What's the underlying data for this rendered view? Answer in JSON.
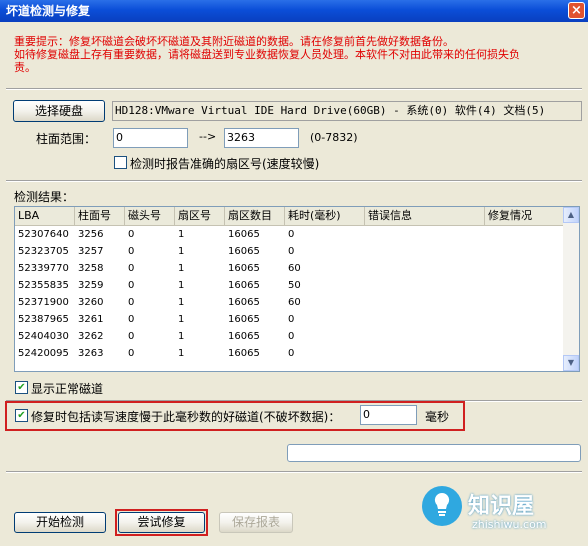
{
  "window": {
    "title": "坏道检测与修复",
    "close_glyph": "×"
  },
  "warning": {
    "line1": "重要提示：修复坏磁道会破坏坏磁道及其附近磁道的数据。请在修复前首先做好数据备份。",
    "line2": "如待修复磁盘上存有重要数据，请将磁盘送到专业数据恢复人员处理。本软件不对由此带来的任何损失负",
    "line3": "责。"
  },
  "disk": {
    "select_button": "选择硬盘",
    "drive_text": "HD128:VMware Virtual IDE Hard Drive(60GB) - 系统(0) 软件(4) 文档(5)"
  },
  "cylinder_range": {
    "label": "柱面范围：",
    "from_value": "0",
    "arrow": "-->",
    "to_value": "3263",
    "range_hint": "(0-7832)"
  },
  "accurate_sector": {
    "checked": false,
    "label": "检测时报告准确的扇区号(速度较慢)"
  },
  "results": {
    "label": "检测结果：",
    "columns": [
      "LBA",
      "柱面号",
      "磁头号",
      "扇区号",
      "扇区数目",
      "耗时(毫秒)",
      "错误信息",
      "修复情况"
    ],
    "rows": [
      [
        "52307640",
        "3256",
        "0",
        "1",
        "16065",
        "0",
        "",
        ""
      ],
      [
        "52323705",
        "3257",
        "0",
        "1",
        "16065",
        "0",
        "",
        ""
      ],
      [
        "52339770",
        "3258",
        "0",
        "1",
        "16065",
        "60",
        "",
        ""
      ],
      [
        "52355835",
        "3259",
        "0",
        "1",
        "16065",
        "50",
        "",
        ""
      ],
      [
        "52371900",
        "3260",
        "0",
        "1",
        "16065",
        "60",
        "",
        ""
      ],
      [
        "52387965",
        "3261",
        "0",
        "1",
        "16065",
        "0",
        "",
        ""
      ],
      [
        "52404030",
        "3262",
        "0",
        "1",
        "16065",
        "0",
        "",
        ""
      ],
      [
        "52420095",
        "3263",
        "0",
        "1",
        "16065",
        "0",
        "",
        ""
      ]
    ]
  },
  "show_normal": {
    "checked": true,
    "label": "显示正常磁道"
  },
  "repair_slow": {
    "checked": true,
    "label": "修复时包括读写速度慢于此毫秒数的好磁道(不破坏数据)：",
    "value": "0",
    "unit": "毫秒"
  },
  "progress": {
    "fraction": 0
  },
  "buttons": {
    "start": "开始检测",
    "repair": "尝试修复",
    "save": "保存报表"
  },
  "watermark": {
    "brand_cn": "知识屋",
    "domain": "zhishiwu.com"
  },
  "colors": {
    "warning_text": "#E00000",
    "highlight_border": "#D02020",
    "titlebar": "#0B4ED8",
    "window_bg": "#ECE9D8"
  }
}
